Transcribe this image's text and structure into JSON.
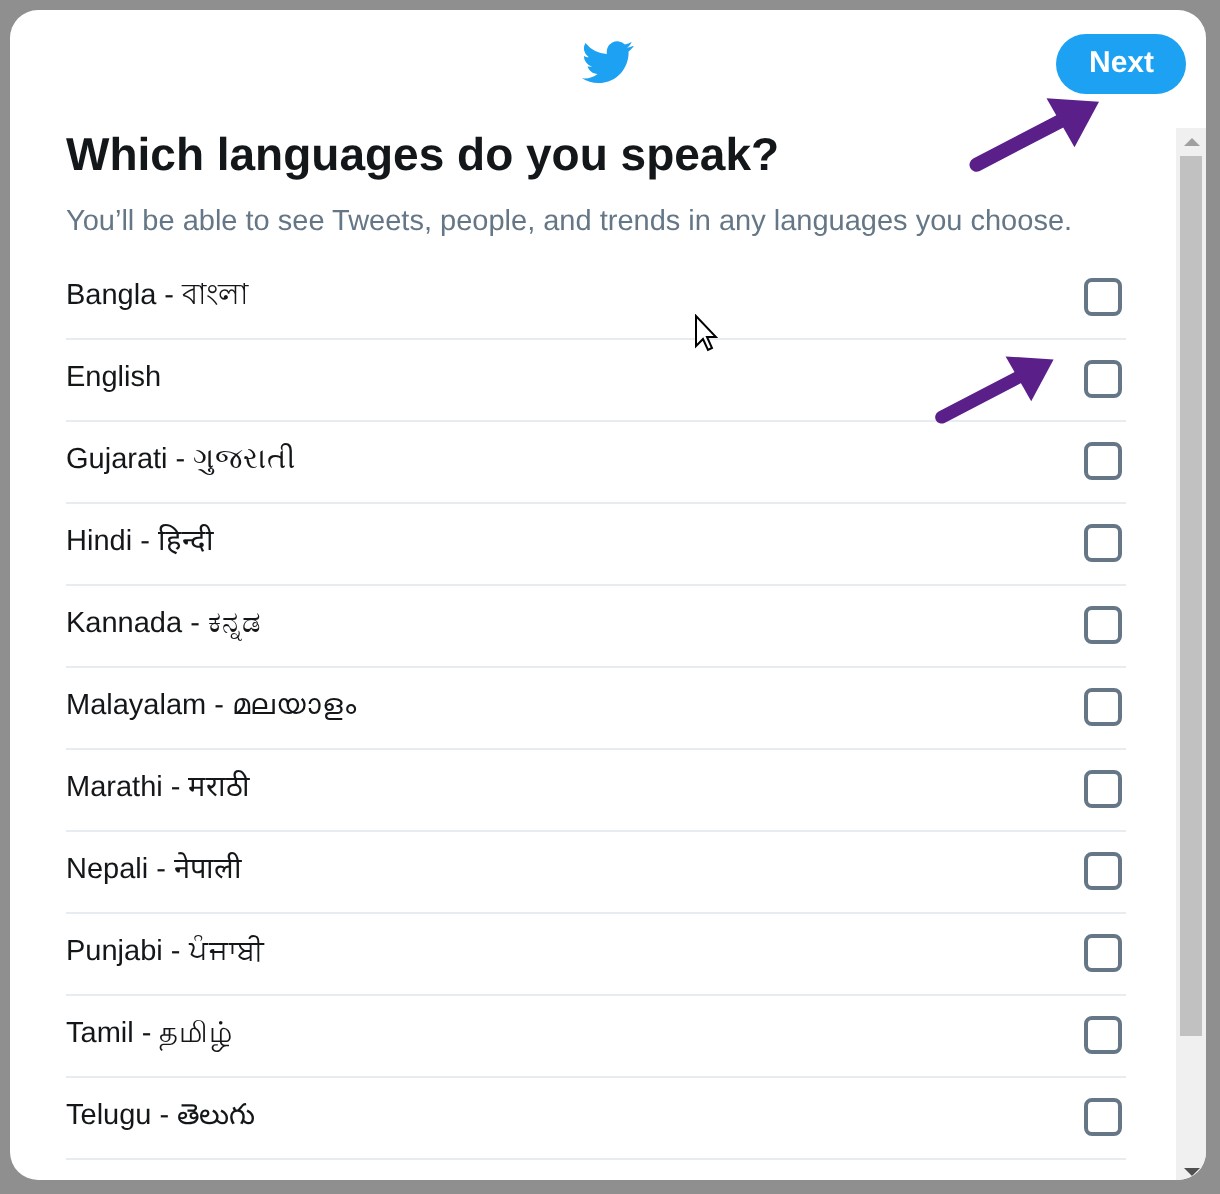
{
  "header": {
    "next_button": "Next"
  },
  "title": "Which languages do you speak?",
  "subtitle": "You’ll be able to see Tweets, people, and trends in any languages you choose.",
  "languages": [
    {
      "label": "Bangla - বাংলা",
      "checked": false
    },
    {
      "label": "English",
      "checked": false
    },
    {
      "label": "Gujarati - ગુજરાતી",
      "checked": false
    },
    {
      "label": "Hindi - हिन्दी",
      "checked": false
    },
    {
      "label": "Kannada - ಕನ್ನಡ",
      "checked": false
    },
    {
      "label": "Malayalam - മലയാളം",
      "checked": false
    },
    {
      "label": "Marathi - मराठी",
      "checked": false
    },
    {
      "label": "Nepali - नेपाली",
      "checked": false
    },
    {
      "label": "Punjabi - ਪੰਜਾਬੀ",
      "checked": false
    },
    {
      "label": "Tamil - தமிழ்",
      "checked": false
    },
    {
      "label": "Telugu - తెలుగు",
      "checked": false
    }
  ]
}
